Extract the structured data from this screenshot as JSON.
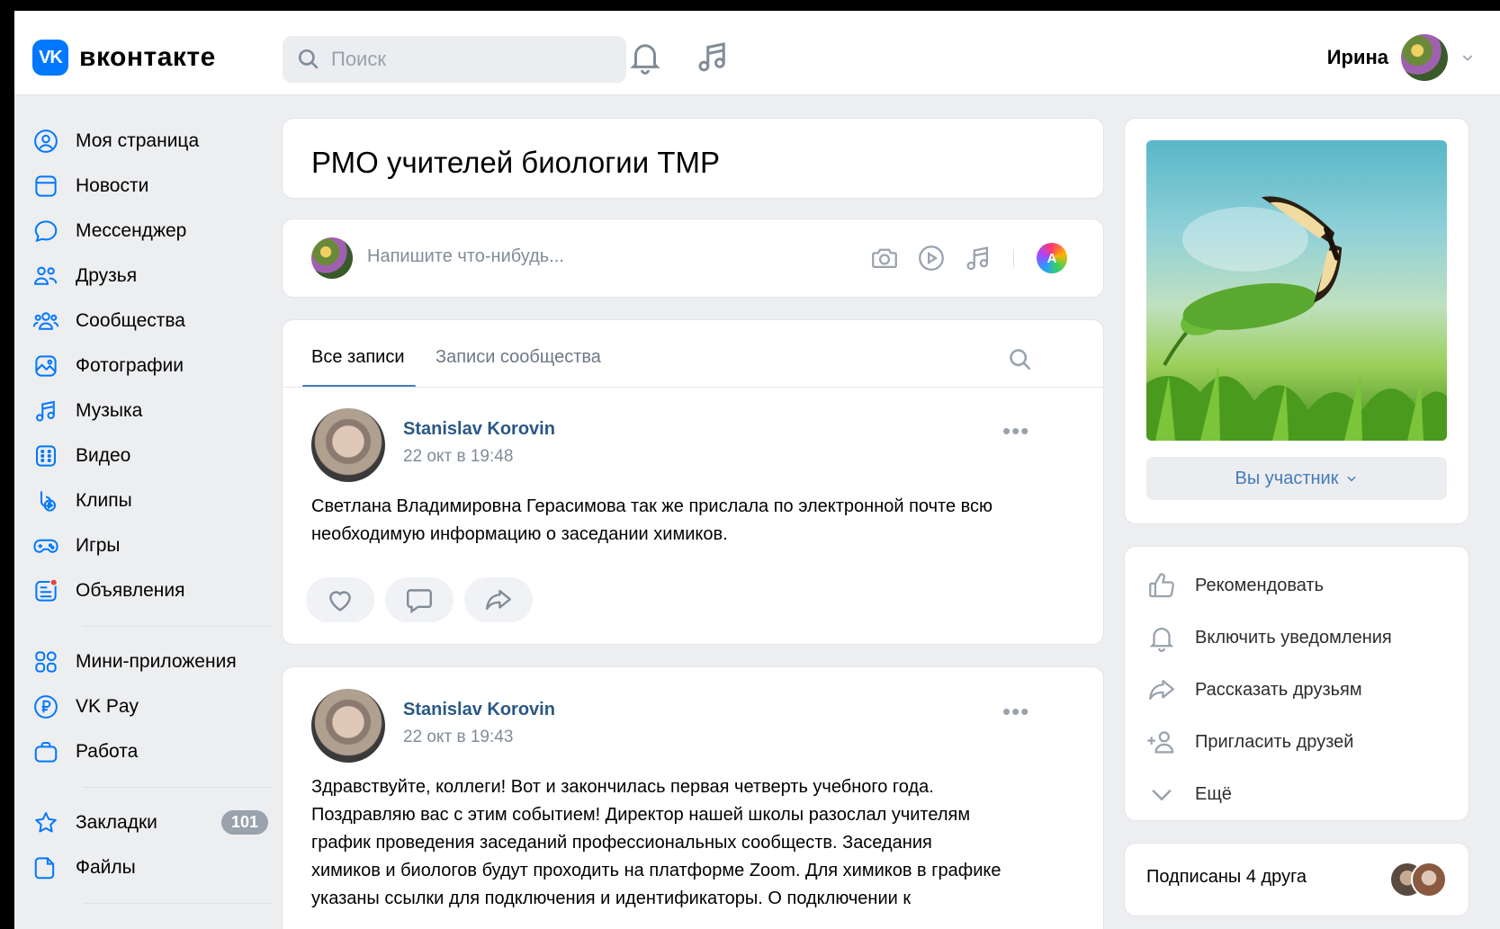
{
  "header": {
    "logo_text": "вконтакте",
    "logo_badge": "VK",
    "search_placeholder": "Поиск",
    "user_name": "Ирина"
  },
  "sidebar": {
    "items": [
      {
        "label": "Моя страница",
        "icon": "user-circle-icon"
      },
      {
        "label": "Новости",
        "icon": "news-icon"
      },
      {
        "label": "Мессенджер",
        "icon": "message-icon"
      },
      {
        "label": "Друзья",
        "icon": "friends-icon"
      },
      {
        "label": "Сообщества",
        "icon": "communities-icon"
      },
      {
        "label": "Фотографии",
        "icon": "photo-icon"
      },
      {
        "label": "Музыка",
        "icon": "music-icon"
      },
      {
        "label": "Видео",
        "icon": "video-icon"
      },
      {
        "label": "Клипы",
        "icon": "clips-icon"
      },
      {
        "label": "Игры",
        "icon": "gamepad-icon"
      },
      {
        "label": "Объявления",
        "icon": "ads-icon"
      }
    ],
    "apps": [
      {
        "label": "Мини-приложения",
        "icon": "apps-icon"
      },
      {
        "label": "VK Pay",
        "icon": "vkpay-icon"
      },
      {
        "label": "Работа",
        "icon": "briefcase-icon"
      }
    ],
    "bookmarks": {
      "label": "Закладки",
      "count": "101"
    },
    "files": {
      "label": "Файлы"
    }
  },
  "group": {
    "title": "РМО учителей биологии ТМР"
  },
  "composer": {
    "placeholder": "Напишите что-нибудь..."
  },
  "tabs": {
    "all": "Все записи",
    "community": "Записи сообщества"
  },
  "posts": [
    {
      "author": "Stanislav Korovin",
      "date": "22 окт в 19:48",
      "text_lines": [
        "Светлана Владимировна Герасимова так же прислала по электронной почте всю",
        "необходимую информацию о заседании химиков."
      ]
    },
    {
      "author": "Stanislav Korovin",
      "date": "22 окт в 19:43",
      "text_lines": [
        "Здравствуйте, коллеги! Вот и закончилась первая четверть учебного года.",
        "Поздравляю вас с этим событием! Директор нашей школы разослал учителям",
        "график проведения заседаний профессиональных сообществ. Заседания",
        "химиков и биологов будут проходить на платформе Zoom. Для химиков в графике",
        "указаны ссылки для подключения и идентификаторы. О подключении к"
      ]
    }
  ],
  "right": {
    "member_button": "Вы участник",
    "actions": [
      {
        "label": "Рекомендовать",
        "icon": "thumbs-up-icon"
      },
      {
        "label": "Включить уведомления",
        "icon": "bell-icon"
      },
      {
        "label": "Рассказать друзьям",
        "icon": "share-icon"
      },
      {
        "label": "Пригласить друзей",
        "icon": "add-user-icon"
      },
      {
        "label": "Ещё",
        "icon": "chevron-down-icon"
      }
    ],
    "friends_subscribed": "Подписаны 4 друга"
  },
  "colors": {
    "accent": "#0077ff",
    "link": "#2a5885",
    "background": "#edeef0"
  }
}
